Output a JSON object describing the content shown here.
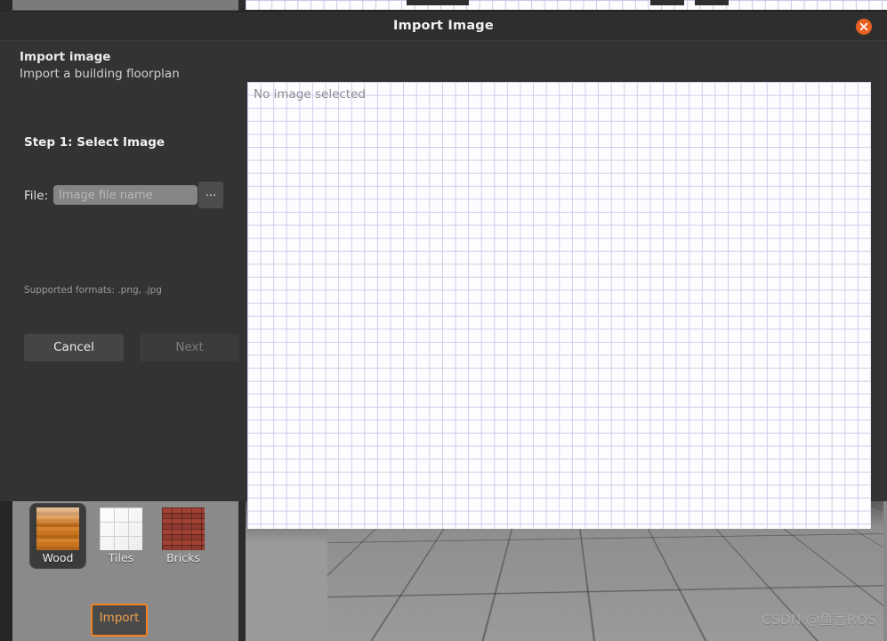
{
  "background_app": {
    "material_palette": {
      "items": [
        {
          "label": "Wood",
          "texture": "wood-texture",
          "selected": true
        },
        {
          "label": "Tiles",
          "texture": "tiles-texture",
          "selected": false
        },
        {
          "label": "Bricks",
          "texture": "bricks-texture",
          "selected": false
        }
      ],
      "import_button_label": "Import",
      "import_button_accent": "#f0821e"
    },
    "watermark": "CSDN @鱼香ROS"
  },
  "dialog": {
    "title": "Import Image",
    "close_icon": "close-icon",
    "close_color": "#e8601f",
    "heading": "Import image",
    "subheading": "Import a building floorplan",
    "step_title": "Step 1: Select Image",
    "file": {
      "label": "File:",
      "value": "",
      "placeholder": "Image file name",
      "browse_label": "..."
    },
    "formats_note": "Supported formats: .png, .jpg",
    "buttons": {
      "cancel": "Cancel",
      "next": "Next"
    },
    "preview": {
      "empty_text": "No image selected"
    }
  }
}
